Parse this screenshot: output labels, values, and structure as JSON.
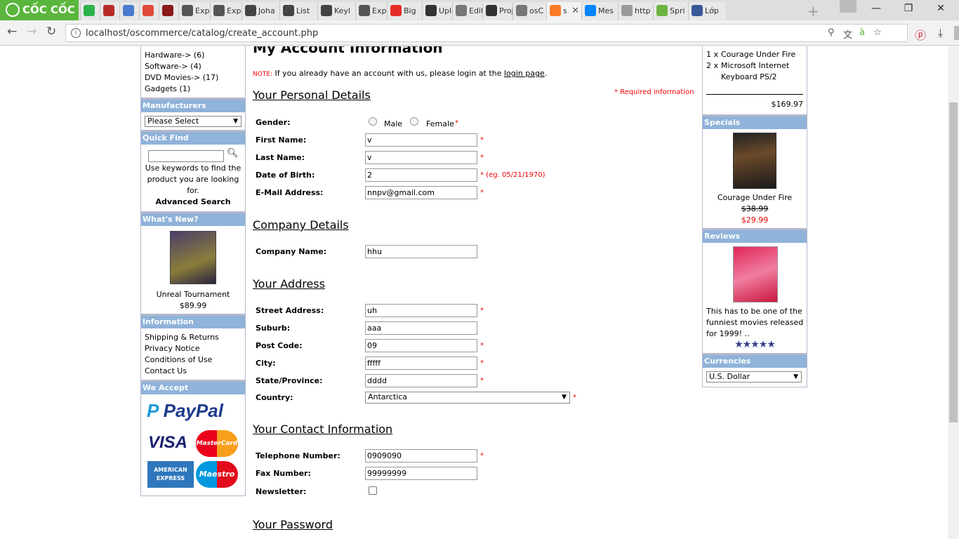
{
  "browser": {
    "brand": "CỐC CỐC",
    "tabs": [
      {
        "label": "",
        "icon": "feedly-icon",
        "color": "#2bb24c"
      },
      {
        "label": "",
        "icon": "quora-icon",
        "color": "#b92b27"
      },
      {
        "label": "",
        "icon": "link-icon",
        "color": "#4a7bd0"
      },
      {
        "label": "",
        "icon": "chrome-icon",
        "color": "#e04b3a"
      },
      {
        "label": "",
        "icon": "app-icon",
        "color": "#8b1a1a"
      },
      {
        "label": "Expr",
        "icon": "express-icon",
        "color": "#555555"
      },
      {
        "label": "Expr",
        "icon": "express-icon",
        "color": "#555555"
      },
      {
        "label": "Joha",
        "icon": "wikipedia-icon",
        "color": "#444444"
      },
      {
        "label": "List",
        "icon": "wikipedia-icon",
        "color": "#444444"
      },
      {
        "label": "Keyl",
        "icon": "wikipedia-icon",
        "color": "#444444"
      },
      {
        "label": "Expr",
        "icon": "express-icon",
        "color": "#555555"
      },
      {
        "label": "Big",
        "icon": "youtube-icon",
        "color": "#e52d27"
      },
      {
        "label": "Uplo",
        "icon": "github-icon",
        "color": "#333333"
      },
      {
        "label": "Edit",
        "icon": "edit-icon",
        "color": "#777777"
      },
      {
        "label": "Proj",
        "icon": "github-icon",
        "color": "#333333"
      },
      {
        "label": "osC",
        "icon": "oscommerce-icon",
        "color": "#777777"
      },
      {
        "label": "s",
        "icon": "xampp-icon",
        "color": "#fb7a24",
        "active": true
      },
      {
        "label": "Mes",
        "icon": "messenger-icon",
        "color": "#0084ff"
      },
      {
        "label": "http",
        "icon": "page-icon",
        "color": "#999999"
      },
      {
        "label": "Spri",
        "icon": "spring-icon",
        "color": "#6db33f"
      },
      {
        "label": "Lớp",
        "icon": "facebook-icon",
        "color": "#3b5998"
      }
    ],
    "url": "localhost/oscommerce/catalog/create_account.php"
  },
  "left": {
    "categories": [
      "Hardware-> (6)",
      "Software-> (4)",
      "DVD Movies-> (17)",
      "Gadgets (1)"
    ],
    "manufacturers_title": "Manufacturers",
    "manufacturers_select": "Please Select",
    "quickfind_title": "Quick Find",
    "quickfind_value": "",
    "quickfind_help": "Use keywords to find the product you are looking for.",
    "advanced_search": "Advanced Search",
    "whatsnew_title": "What's New?",
    "whatsnew_product": "Unreal Tournament",
    "whatsnew_price": "$89.99",
    "information_title": "Information",
    "information_links": [
      "Shipping & Returns",
      "Privacy Notice",
      "Conditions of Use",
      "Contact Us"
    ],
    "weaccept_title": "We Accept",
    "payment_logos": [
      "PayPal",
      "VISA",
      "MasterCard",
      "AMERICAN EXPRESS",
      "Maestro"
    ]
  },
  "main": {
    "heading": "My Account Information",
    "note_label": "NOTE:",
    "note_text": " If you already have an account with us, please login at the ",
    "note_link": "login page",
    "note_end": ".",
    "required_info": "* Required information",
    "personal_title": "Your Personal Details",
    "gender_label": "Gender:",
    "gender_male": "Male",
    "gender_female": "Female",
    "firstname_label": "First Name:",
    "firstname_value": "v",
    "lastname_label": "Last Name:",
    "lastname_value": "v",
    "dob_label": "Date of Birth:",
    "dob_value": "2",
    "dob_hint": "* (eg. 05/21/1970)",
    "email_label": "E-Mail Address:",
    "email_value": "nnpv@gmail.com",
    "company_title": "Company Details",
    "company_label": "Company Name:",
    "company_value": "hhu",
    "address_title": "Your Address",
    "street_label": "Street Address:",
    "street_value": "uh",
    "suburb_label": "Suburb:",
    "suburb_value": "aaa",
    "postcode_label": "Post Code:",
    "postcode_value": "09",
    "city_label": "City:",
    "city_value": "fffff",
    "state_label": "State/Province:",
    "state_value": "dddd",
    "country_label": "Country:",
    "country_value": "Antarctica",
    "contact_title": "Your Contact Information",
    "phone_label": "Telephone Number:",
    "phone_value": "0909090",
    "fax_label": "Fax Number:",
    "fax_value": "99999999",
    "newsletter_label": "Newsletter:",
    "password_title": "Your Password",
    "req_star": "*"
  },
  "right": {
    "cart_items": [
      {
        "qty": "1 x",
        "name": "Courage Under Fire"
      },
      {
        "qty": "2 x",
        "name": "Microsoft Internet Keyboard PS/2"
      }
    ],
    "cart_total": "$169.97",
    "specials_title": "Specials",
    "specials_product": "Courage Under Fire",
    "specials_old_price": "$38.99",
    "specials_new_price": "$29.99",
    "reviews_title": "Reviews",
    "review_text": "This has to be one of the funniest movies released for 1999! ..",
    "review_stars": "★★★★★",
    "currencies_title": "Currencies",
    "currency_value": "U.S. Dollar"
  }
}
